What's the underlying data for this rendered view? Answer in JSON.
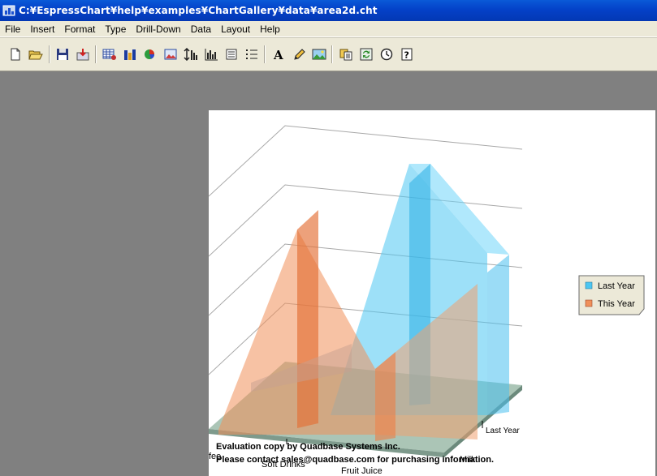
{
  "window": {
    "title": "C:¥EspressChart¥help¥examples¥ChartGallery¥data¥area2d.cht"
  },
  "menu": [
    "File",
    "Insert",
    "Format",
    "Type",
    "Drill-Down",
    "Data",
    "Layout",
    "Help"
  ],
  "toolbar": {
    "buttons": [
      "new-file",
      "open-folder",
      "save",
      "export",
      "data-source",
      "chart-type",
      "pie-chart",
      "insert-image",
      "axis-scale",
      "histogram",
      "list-view",
      "numbered-list",
      "text-format",
      "pencil-draw",
      "image-background",
      "copy",
      "refresh",
      "timer",
      "help"
    ]
  },
  "colors": {
    "last_year": "#4cc6f2",
    "this_year": "#f0905a",
    "floor": "#a6c2b2",
    "titlebar": "#0441c8"
  },
  "chart_data": {
    "type": "area",
    "categories": [
      "Soft Drinks",
      "Fruit Juice",
      "Milk",
      "Coffee"
    ],
    "series": [
      {
        "name": "This Year",
        "color": "#f0905a"
      },
      {
        "name": "Last Year",
        "color": "#4cc6f2"
      }
    ],
    "legend": {
      "position": "right",
      "items": [
        "Last Year",
        "This Year"
      ]
    },
    "axis_labels": {
      "category_visible": [
        "Soft Drinks",
        "Fruit Juice",
        "Milk",
        "fee"
      ],
      "series_visible": [
        "Last Year"
      ]
    },
    "grid": true,
    "three_d": true
  },
  "watermark": {
    "line1": "Evaluation copy by Quadbase Systems Inc.",
    "line2": "Please contact sales@quadbase.com for purchasing information."
  }
}
